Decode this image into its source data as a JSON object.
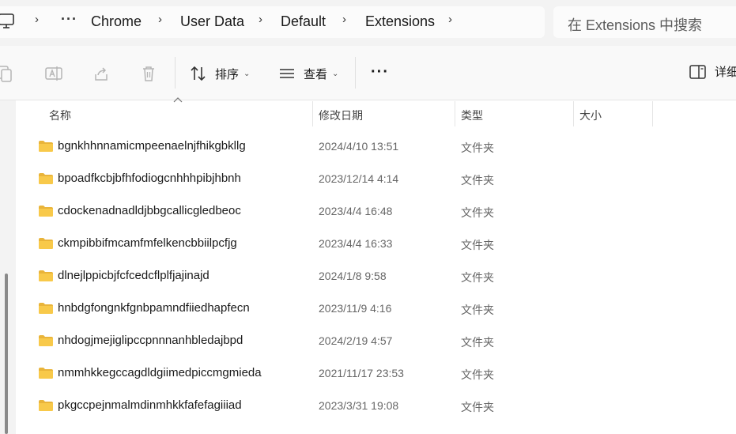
{
  "address_bar": {
    "overflow": "···",
    "crumbs": [
      "Chrome",
      "User Data",
      "Default",
      "Extensions"
    ],
    "separator": "›"
  },
  "search": {
    "placeholder": "在 Extensions 中搜索"
  },
  "toolbar": {
    "sort_label": "排序",
    "view_label": "查看",
    "more_label": "···",
    "details_label": "详细"
  },
  "columns": {
    "name": "名称",
    "date": "修改日期",
    "type": "类型",
    "size": "大小"
  },
  "files": [
    {
      "name": "bgnkhhnnamicmpeenaelnjfhikgbkllg",
      "date": "2024/4/10 13:51",
      "type": "文件夹"
    },
    {
      "name": "bpoadfkcbjbfhfodiogcnhhhpibjhbnh",
      "date": "2023/12/14 4:14",
      "type": "文件夹"
    },
    {
      "name": "cdockenadnadldjbbgcallicgledbeoc",
      "date": "2023/4/4 16:48",
      "type": "文件夹"
    },
    {
      "name": "ckmpibbifmcamfmfelkencbbiilpcfjg",
      "date": "2023/4/4 16:33",
      "type": "文件夹"
    },
    {
      "name": "dlnejlppicbjfcfcedcflplfjajinajd",
      "date": "2024/1/8 9:58",
      "type": "文件夹"
    },
    {
      "name": "hnbdgfongnkfgnbpamndfiiedhapfecn",
      "date": "2023/11/9 4:16",
      "type": "文件夹"
    },
    {
      "name": "nhdogjmejiglipccpnnnanhbledajbpd",
      "date": "2024/2/19 4:57",
      "type": "文件夹"
    },
    {
      "name": "nmmhkkegccagdldgiimedpiccmgmieda",
      "date": "2021/11/17 23:53",
      "type": "文件夹"
    },
    {
      "name": "pkgccpejnmalmdinmhkkfafefagiiiad",
      "date": "2023/3/31 19:08",
      "type": "文件夹"
    }
  ],
  "icons": {
    "folder": "folder-icon",
    "colors": {
      "folder": "#f8c94a",
      "folder_tab": "#e9b43a"
    }
  }
}
